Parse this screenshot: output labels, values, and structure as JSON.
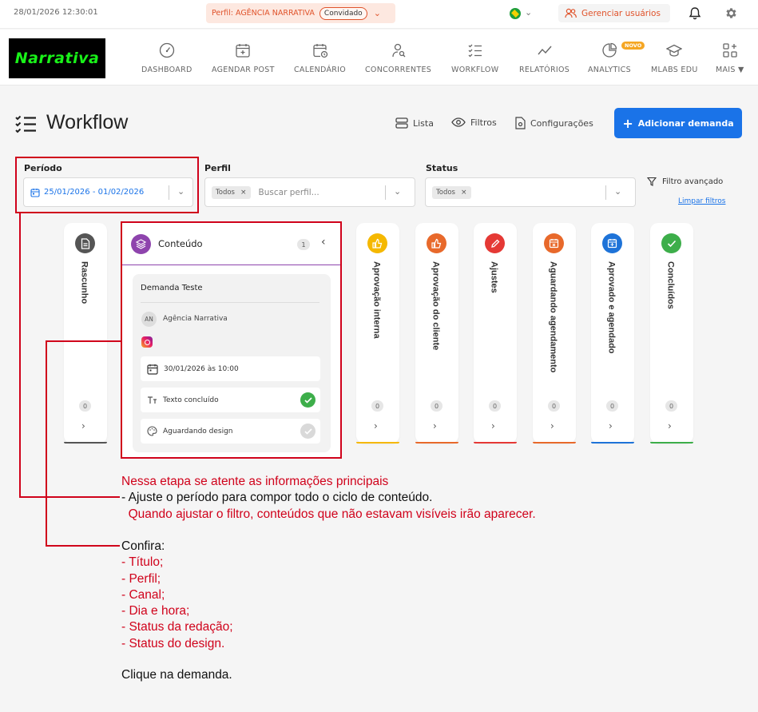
{
  "topbar": {
    "datetime": "28/01/2026  12:30:01",
    "profile_label": "Perfil: AGÊNCIA NARRATIVA",
    "profile_badge": "Convidado",
    "manage_users": "Gerenciar usuários"
  },
  "logo": {
    "text": "Narrativa"
  },
  "nav": {
    "items": [
      {
        "label": "DASHBOARD",
        "icon": "gauge-icon"
      },
      {
        "label": "AGENDAR POST",
        "icon": "calendar-plus-icon"
      },
      {
        "label": "CALENDÁRIO",
        "icon": "calendar-clock-icon"
      },
      {
        "label": "CONCORRENTES",
        "icon": "user-search-icon"
      },
      {
        "label": "WORKFLOW",
        "icon": "checklist-icon"
      },
      {
        "label": "RELATÓRIOS",
        "icon": "line-chart-icon"
      },
      {
        "label": "ANALYTICS",
        "icon": "pie-chart-icon"
      },
      {
        "label": "MLABS EDU",
        "icon": "graduation-cap-icon"
      },
      {
        "label": "MAIS ▼",
        "icon": "grid-plus-icon"
      }
    ],
    "new_badge": "NOVO"
  },
  "page": {
    "title": "Workflow",
    "list_btn": "Lista",
    "filters_btn": "Filtros",
    "settings_btn": "Configurações",
    "add_btn": "Adicionar demanda"
  },
  "filters": {
    "period_label": "Período",
    "period_value": "25/01/2026 - 01/02/2026",
    "profile_label": "Perfil",
    "profile_tag": "Todos",
    "profile_placeholder": "Buscar perfil...",
    "status_label": "Status",
    "status_tag": "Todos",
    "advanced": "Filtro avançado",
    "clear": "Limpar filtros"
  },
  "columns": [
    {
      "label": "Rascunho",
      "count": "0",
      "color": "#555555"
    },
    {
      "label": "Aprovação interna",
      "count": "0",
      "color": "#f5b800"
    },
    {
      "label": "Aprovação do cliente",
      "count": "0",
      "color": "#e8692b"
    },
    {
      "label": "Ajustes",
      "count": "0",
      "color": "#e53935"
    },
    {
      "label": "Aguardando agendamento",
      "count": "0",
      "color": "#e8692b"
    },
    {
      "label": "Aprovado e agendado",
      "count": "0",
      "color": "#1e73d8"
    },
    {
      "label": "Concluídos",
      "count": "0",
      "color": "#3dae4a"
    }
  ],
  "expanded": {
    "title": "Conteúdo",
    "count": "1",
    "color": "#8e44ad",
    "card": {
      "title": "Demanda Teste",
      "avatar": "AN",
      "profile": "Agência Narrativa",
      "datetime": "30/01/2026 às 10:00",
      "text_status": "Texto concluído",
      "design_status": "Aguardando design"
    }
  },
  "annotations": {
    "l1": "Nessa etapa se atente as informações principais",
    "l2": "- Ajuste o período para compor todo o ciclo de conteúdo.",
    "l3": "  Quando ajustar o filtro, conteúdos que não estavam visíveis irão aparecer.",
    "l4": "Confira:",
    "l5": "- Título;",
    "l6": "- Perfil;",
    "l7": "- Canal;",
    "l8": "- Dia e hora;",
    "l9": "- Status da redação;",
    "l10": "- Status do design.",
    "l11": "Clique na demanda."
  }
}
